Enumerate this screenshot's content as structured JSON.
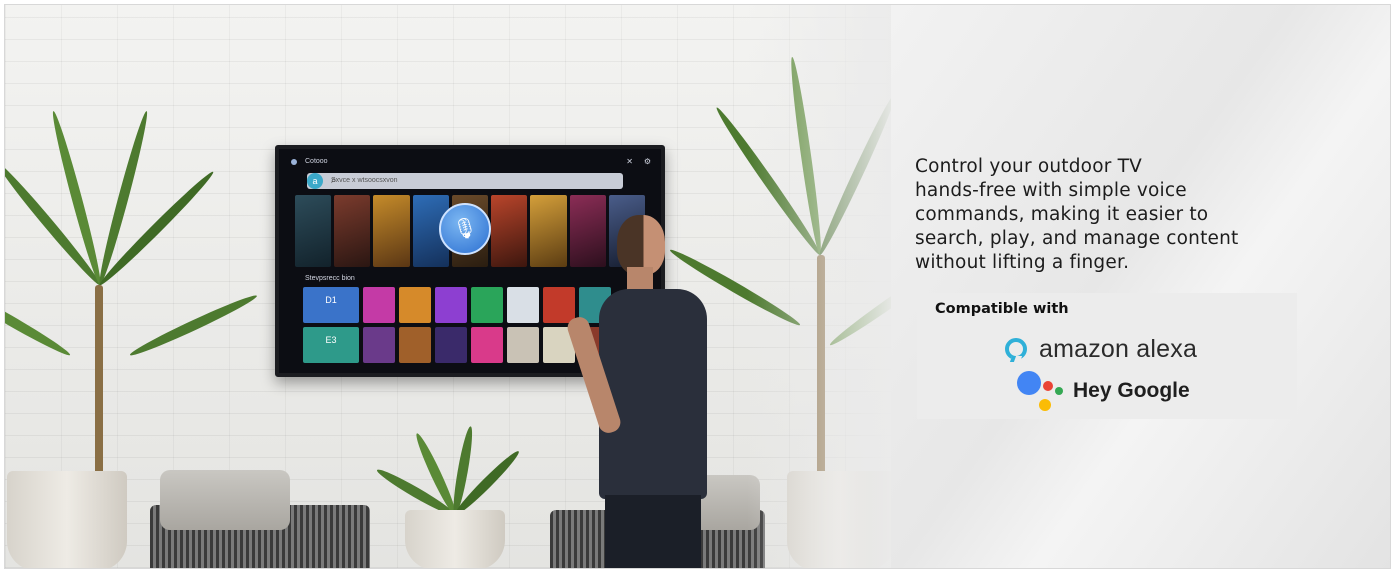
{
  "description": "Control your outdoor TV hands-free with simple voice commands, making it easier to search, play, and manage content without lifting a finger.",
  "description_lines": [
    "Control your outdoor TV",
    "hands-free with simple voice",
    "commands, making it easier to",
    "search, play, and manage content",
    "without lifting a finger."
  ],
  "compatible": {
    "title": "Compatible with",
    "alexa_label": "amazon alexa",
    "google_label": "Hey Google"
  },
  "tv_screen": {
    "app_title": "Cotooo",
    "search_placeholder": "Sxvce x wtsoocsxvon",
    "row_label": "Stevpsrecc bion",
    "tile_1": "D1",
    "tile_2": "E3"
  },
  "colors": {
    "alexa": "#2fb0d8",
    "google_blue": "#4285f4",
    "google_red": "#ea4335",
    "google_yellow": "#fbbc05",
    "google_green": "#34a853"
  }
}
